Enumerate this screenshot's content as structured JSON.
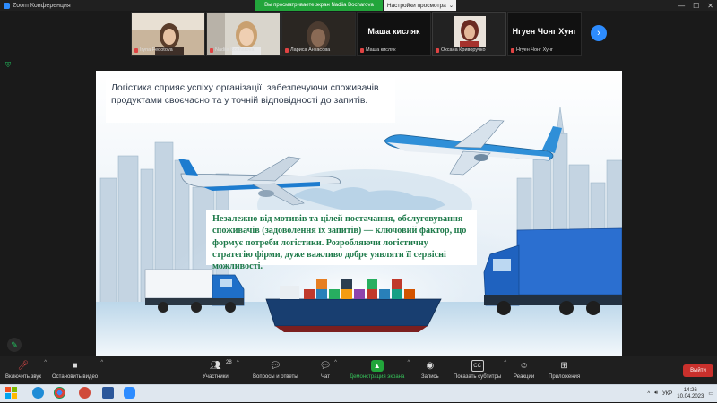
{
  "window": {
    "title": "Zoom Конференция"
  },
  "banner": {
    "share_text": "Вы просматриваете экран Nadiia Bocharova",
    "view_options": "Настройки просмотра"
  },
  "participants": [
    {
      "name": "Iryna Fedotova"
    },
    {
      "name": "Nadiia Bocharova"
    },
    {
      "name": "Лариса Анкасова"
    },
    {
      "name": "Маша кисляк",
      "big": "Маша кисляк"
    },
    {
      "name": "Оксана Криворучко"
    },
    {
      "name": "Нгуен Чонг Хунг",
      "big": "Нгуен Чонг Хунг"
    }
  ],
  "slide": {
    "text1": "Логістика сприяє успіху організації, забезпечуючи споживачів продуктами своєчасно та у точній відповідності до запитів.",
    "text2": "Незалежно від мотивів та цілей постачання, обслуговування споживачів (задоволення їх запитів) — ключовий фактор, що формує потреби логістики. Розробляючи логістичну стратегію фірми, дуже важливо добре уявляти її сервісні можливості."
  },
  "controls": {
    "audio": "Включить звук",
    "video": "Остановить видео",
    "participants": "Участники",
    "participants_count": "28",
    "qa": "Вопросы и ответы",
    "chat": "Чат",
    "share": "Демонстрация экрана",
    "record": "Запись",
    "captions": "Показать субтитры",
    "reactions": "Реакции",
    "apps": "Приложения",
    "leave": "Выйти"
  },
  "taskbar": {
    "lang": "УКР",
    "time": "14:26",
    "date": "10.04.2023"
  },
  "colors": {
    "zoom_blue": "#2d8cff",
    "share_green": "#22a53b",
    "leave_red": "#c9302c",
    "slide_text_green": "#1e7a4a"
  }
}
